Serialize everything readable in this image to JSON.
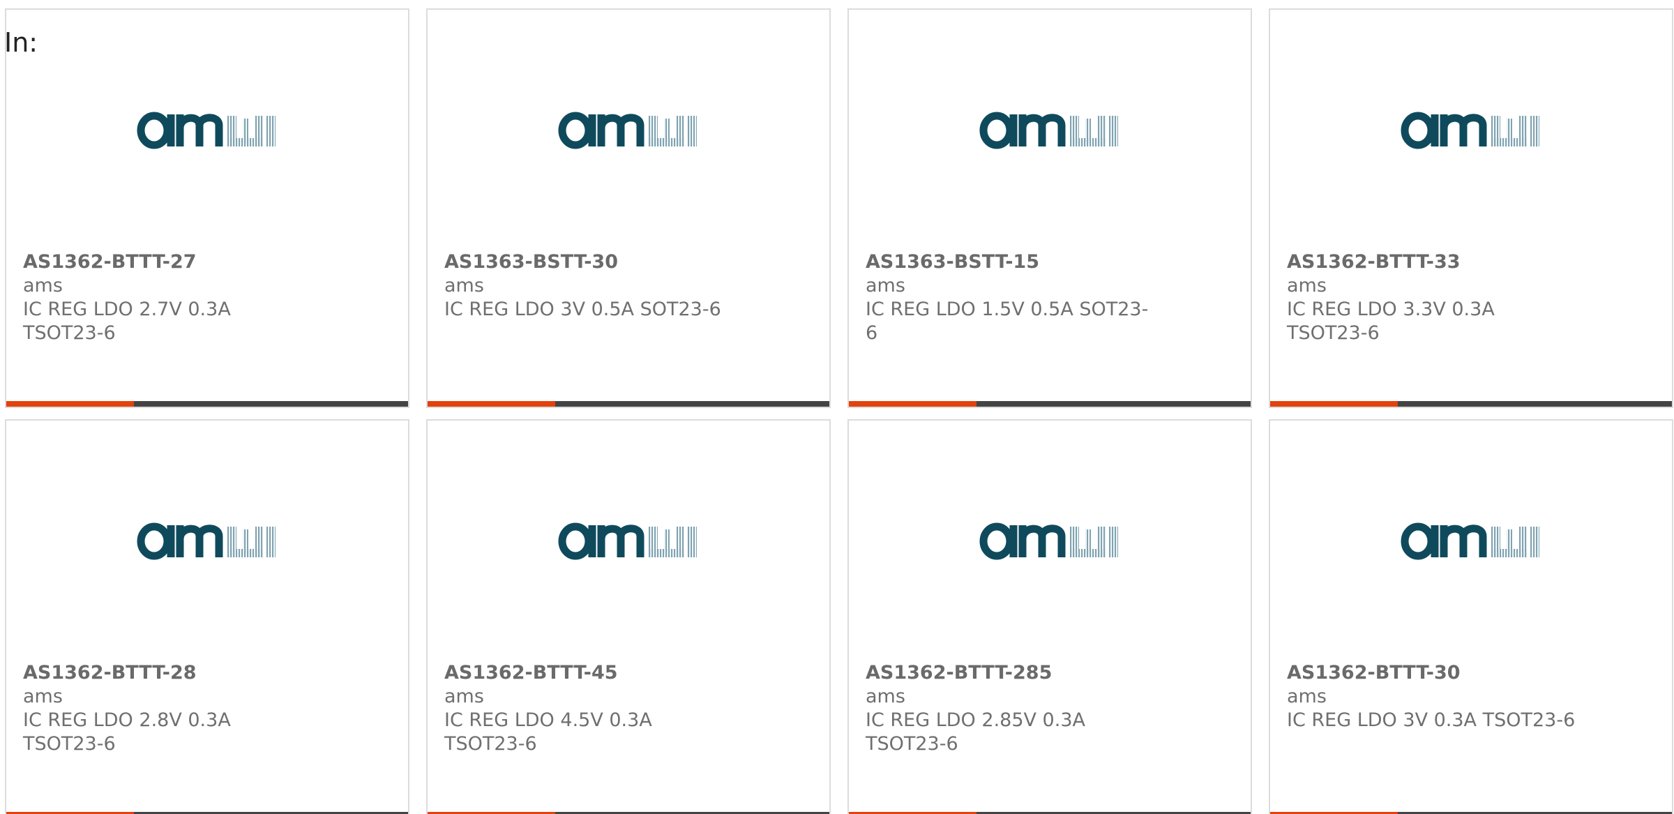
{
  "header": {
    "in_label": "In:"
  },
  "brand": {
    "logo_text": "ams",
    "logo_color": "#0f4a5c",
    "logo_pattern_color": "#7fa3b1"
  },
  "colors": {
    "accent": "#e2420d",
    "bar": "#444444",
    "card_border": "#dcdcdc",
    "text": "#6f6f6f"
  },
  "products": [
    {
      "part_number": "AS1362-BTTT-27",
      "manufacturer": "ams",
      "description": "IC REG LDO 2.7V 0.3A TSOT23-6"
    },
    {
      "part_number": "AS1363-BSTT-30",
      "manufacturer": "ams",
      "description": "IC REG LDO 3V 0.5A SOT23-6"
    },
    {
      "part_number": "AS1363-BSTT-15",
      "manufacturer": "ams",
      "description": "IC REG LDO 1.5V 0.5A SOT23-6"
    },
    {
      "part_number": "AS1362-BTTT-33",
      "manufacturer": "ams",
      "description": "IC REG LDO 3.3V 0.3A TSOT23-6"
    },
    {
      "part_number": "AS1362-BTTT-28",
      "manufacturer": "ams",
      "description": "IC REG LDO 2.8V 0.3A TSOT23-6"
    },
    {
      "part_number": "AS1362-BTTT-45",
      "manufacturer": "ams",
      "description": "IC REG LDO 4.5V 0.3A TSOT23-6"
    },
    {
      "part_number": "AS1362-BTTT-285",
      "manufacturer": "ams",
      "description": "IC REG LDO 2.85V 0.3A TSOT23-6"
    },
    {
      "part_number": "AS1362-BTTT-30",
      "manufacturer": "ams",
      "description": "IC REG LDO 3V 0.3A TSOT23-6"
    }
  ]
}
